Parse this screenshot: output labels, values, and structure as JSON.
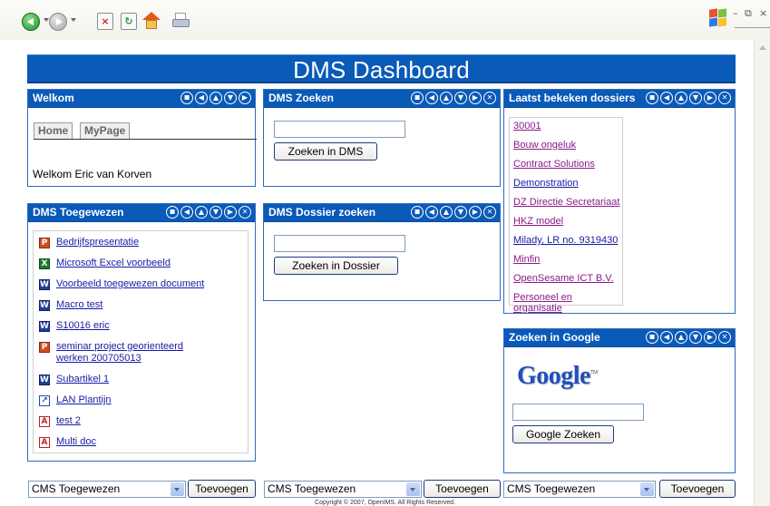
{
  "window": {
    "minimize": "–",
    "restore": "⧉",
    "close": "×"
  },
  "dashboard": {
    "title": "DMS Dashboard"
  },
  "welkom": {
    "title": "Welkom",
    "tabs": [
      "Home",
      "MyPage"
    ],
    "greeting": "Welkom Eric van Korven"
  },
  "dms_zoeken": {
    "title": "DMS Zoeken",
    "input_value": "",
    "button": "Zoeken in DMS"
  },
  "laatst": {
    "title": "Laatst bekeken dossiers",
    "items": [
      "30001",
      "Bouw ongeluk",
      "Contract Solutions",
      "Demonstration",
      "DZ Directie Secretariaat",
      "HKZ model",
      "Milady, LR no. 9319430",
      "Minfin",
      "OpenSesame ICT B.V.",
      "Personeel en organisatie"
    ]
  },
  "toegewezen": {
    "title": "DMS Toegewezen",
    "items": [
      {
        "label": "Bedrijfspresentatie",
        "type": "ppt"
      },
      {
        "label": "Microsoft Excel voorbeeld",
        "type": "xls"
      },
      {
        "label": "Voorbeeld toegewezen document",
        "type": "doc"
      },
      {
        "label": "Macro test",
        "type": "doc"
      },
      {
        "label": "S10016 eric",
        "type": "doc"
      },
      {
        "label": "seminar project georienteerd werken 200705013",
        "type": "ppt"
      },
      {
        "label": "Subartikel 1",
        "type": "doc"
      },
      {
        "label": "LAN Plantijn",
        "type": "link"
      },
      {
        "label": "test 2",
        "type": "pdf"
      },
      {
        "label": "Multi doc",
        "type": "pdf"
      }
    ]
  },
  "dossier_zoeken": {
    "title": "DMS Dossier zoeken",
    "input_value": "",
    "button": "Zoeken in Dossier"
  },
  "google": {
    "title": "Zoeken in Google",
    "logo": "Google",
    "tm": "TM",
    "input_value": "",
    "button": "Google Zoeken"
  },
  "bottom_bar": [
    {
      "selected": "CMS Toegewezen",
      "button": "Toevoegen"
    },
    {
      "selected": "CMS Toegewezen",
      "button": "Toevoegen"
    },
    {
      "selected": "CMS Toegewezen",
      "button": "Toevoegen"
    }
  ],
  "footer": {
    "copyright": "Copyright © 2007, OpenIMS. All Rights Reserved."
  },
  "colors": {
    "header_blue": "#0a5ab8",
    "link": "#1a1aa6",
    "visited_link": "#8b1a8b"
  }
}
